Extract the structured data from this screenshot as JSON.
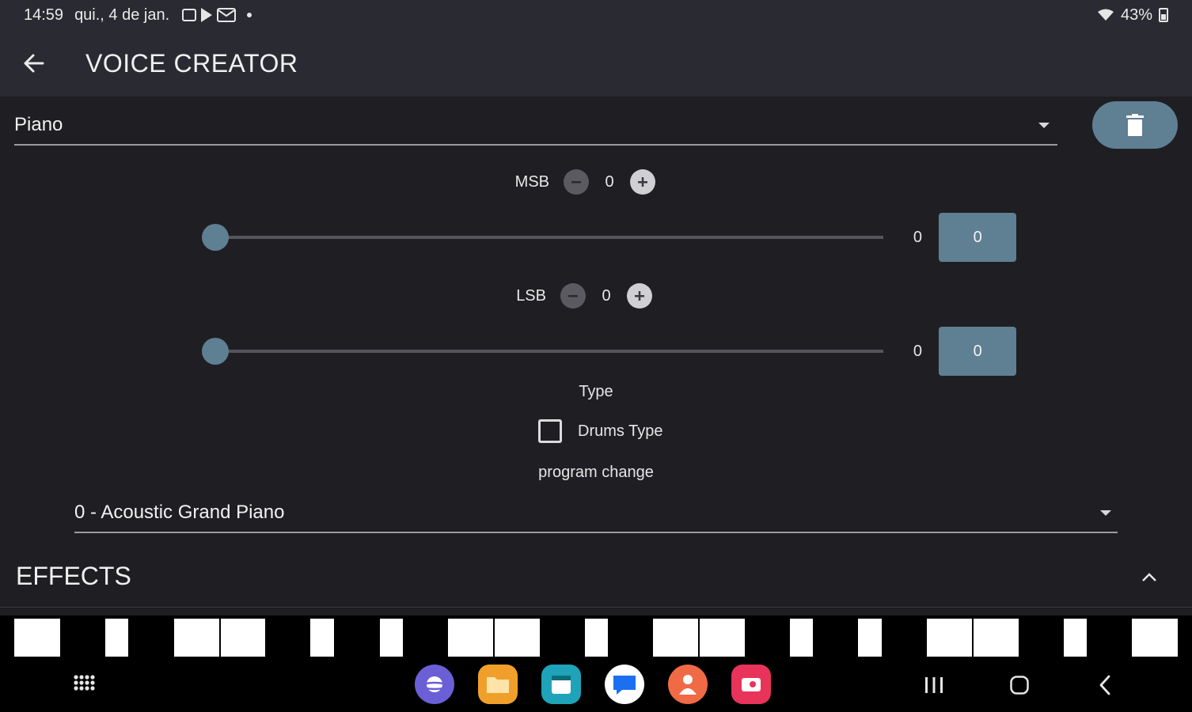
{
  "status_bar": {
    "time": "14:59",
    "date": "qui., 4 de jan.",
    "battery": "43%"
  },
  "app_bar": {
    "title": "VOICE CREATOR"
  },
  "voice": {
    "selected": "Piano"
  },
  "msb": {
    "label": "MSB",
    "value": "0",
    "slider_value": 0,
    "slider_max": 127,
    "display": "0",
    "input_value": "0"
  },
  "lsb": {
    "label": "LSB",
    "value": "0",
    "slider_value": 0,
    "slider_max": 127,
    "display": "0",
    "input_value": "0"
  },
  "type_label": "Type",
  "drums_type": {
    "label": "Drums Type",
    "checked": false
  },
  "program_change_label": "program change",
  "program": {
    "selected": "0 - Acoustic Grand Piano"
  },
  "effects": {
    "title": "EFFECTS"
  },
  "colors": {
    "accent": "#5f7f93",
    "background": "#1f1f23",
    "bar": "#2a2a33"
  },
  "nav_apps": [
    {
      "name": "internet-app-icon",
      "color": "#6b5fd6"
    },
    {
      "name": "files-app-icon",
      "color": "#f0a02a"
    },
    {
      "name": "calendar-app-icon",
      "color": "#1fa3b8"
    },
    {
      "name": "messages-app-icon",
      "color": "#ffffff"
    },
    {
      "name": "contacts-app-icon",
      "color": "#f06a45"
    },
    {
      "name": "screen-recorder-app-icon",
      "color": "#e8335a"
    }
  ],
  "calendar_day": "4"
}
